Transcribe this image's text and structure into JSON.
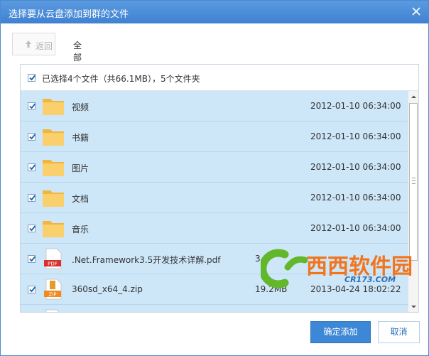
{
  "dialog": {
    "title": "选择要从云盘添加到群的文件",
    "close_label": "×"
  },
  "toolbar": {
    "back_label": "返回",
    "breadcrumb": "全部文件"
  },
  "list": {
    "summary": "已选择4个文件（共66.1MB），5个文件夹",
    "rows": [
      {
        "name": "视频",
        "size": "",
        "date": "2012-01-10 06:34:00",
        "icon": "folder-icon",
        "checked": true
      },
      {
        "name": "书籍",
        "size": "",
        "date": "2012-01-10 06:34:00",
        "icon": "folder-icon",
        "checked": true
      },
      {
        "name": "图片",
        "size": "",
        "date": "2012-01-10 06:34:00",
        "icon": "folder-icon",
        "checked": true
      },
      {
        "name": "文档",
        "size": "",
        "date": "2012-01-10 06:34:00",
        "icon": "folder-icon",
        "checked": true
      },
      {
        "name": "音乐",
        "size": "",
        "date": "2012-01-10 06:34:00",
        "icon": "folder-icon",
        "checked": true
      },
      {
        "name": ".Net.Framework3.5开发技术详解.pdf",
        "size": "3",
        "date": "",
        "icon": "pdf-icon",
        "checked": true
      },
      {
        "name": "360sd_x64_4.zip",
        "size": "19.2MB",
        "date": "2013-04-24 18:02:22",
        "icon": "zip-icon",
        "checked": true
      },
      {
        "name": "",
        "size": "",
        "date": "",
        "icon": "file-icon",
        "checked": false
      }
    ]
  },
  "buttons": {
    "confirm_label": "确定添加",
    "cancel_label": "取消"
  },
  "watermark": {
    "text": "西西软件园",
    "sub": "CR173.COM"
  },
  "colors": {
    "titlebar": "#4a8ad0",
    "row_selected": "#cde6f8",
    "primary_button": "#3d88d6",
    "folder": "#f7c75a"
  }
}
